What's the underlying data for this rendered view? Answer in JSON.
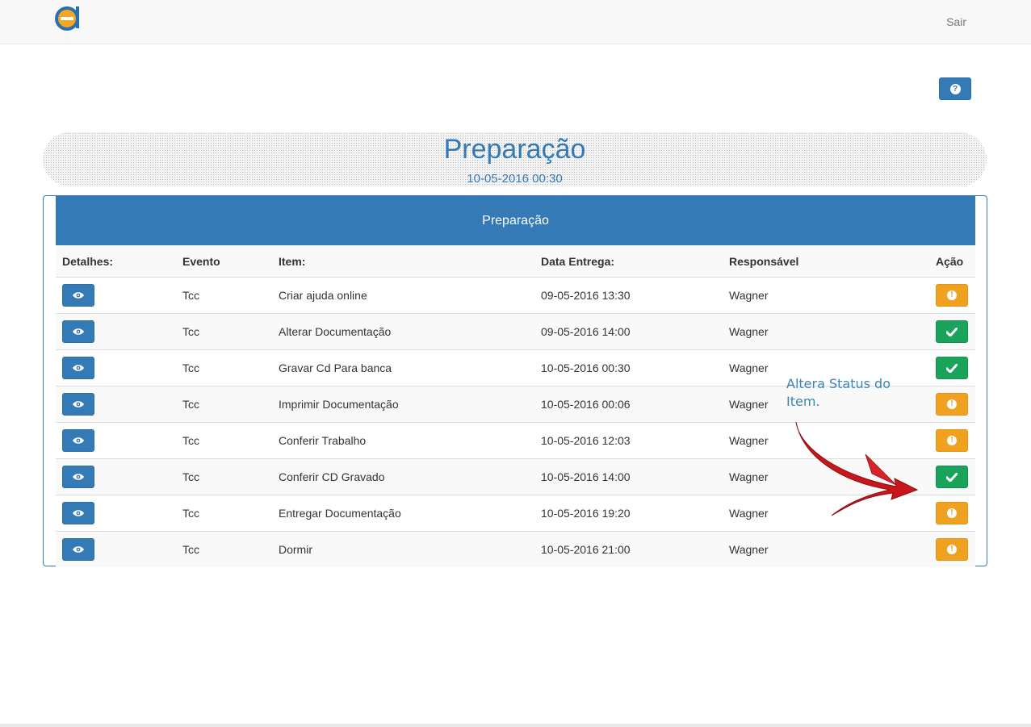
{
  "nav": {
    "logout_label": "Sair"
  },
  "header": {
    "title": "Preparação",
    "date": "10-05-2016 00:30",
    "help_icon": "question-circle-icon"
  },
  "panel": {
    "heading": "Preparação",
    "columns": [
      "Detalhes:",
      "Evento",
      "Item:",
      "Data Entrega:",
      "Responsável",
      "Ação"
    ],
    "rows": [
      {
        "evento": "Tcc",
        "item": "Criar ajuda online",
        "data": "09-05-2016 13:30",
        "responsavel": "Wagner",
        "status": "warning"
      },
      {
        "evento": "Tcc",
        "item": "Alterar Documentação",
        "data": "09-05-2016 14:00",
        "responsavel": "Wagner",
        "status": "done"
      },
      {
        "evento": "Tcc",
        "item": "Gravar Cd Para banca",
        "data": "10-05-2016 00:30",
        "responsavel": "Wagner",
        "status": "done"
      },
      {
        "evento": "Tcc",
        "item": "Imprimir Documentação",
        "data": "10-05-2016 00:06",
        "responsavel": "Wagner",
        "status": "warning"
      },
      {
        "evento": "Tcc",
        "item": "Conferir Trabalho",
        "data": "10-05-2016 12:03",
        "responsavel": "Wagner",
        "status": "warning"
      },
      {
        "evento": "Tcc",
        "item": "Conferir CD Gravado",
        "data": "10-05-2016 14:00",
        "responsavel": "Wagner",
        "status": "done"
      },
      {
        "evento": "Tcc",
        "item": "Entregar Documentação",
        "data": "10-05-2016 19:20",
        "responsavel": "Wagner",
        "status": "warning"
      },
      {
        "evento": "Tcc",
        "item": "Dormir",
        "data": "10-05-2016 21:00",
        "responsavel": "Wagner",
        "status": "warning"
      }
    ]
  },
  "annotation": {
    "text": "Altera Status do Item."
  },
  "colors": {
    "primary": "#337ab7",
    "warning": "#f0a120",
    "success": "#1aa35a",
    "arrow": "#c8161d"
  }
}
